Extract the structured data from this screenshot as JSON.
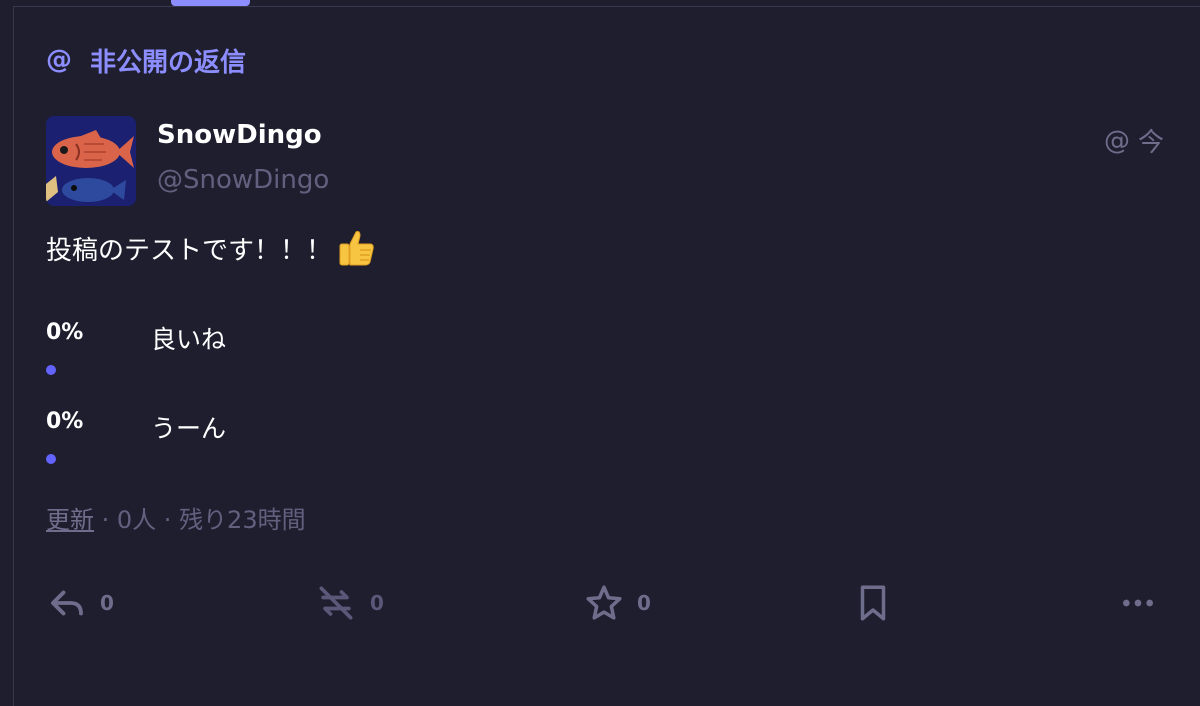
{
  "header": {
    "title": "非公開の返信",
    "at_symbol": "@"
  },
  "post": {
    "display_name": "SnowDingo",
    "handle": "@SnowDingo",
    "visibility_symbol": "@",
    "time": "今",
    "content": "投稿のテストです！！！",
    "content_emoji": "thumbs-up"
  },
  "poll": {
    "options": [
      {
        "percent": "0%",
        "label": "良いね",
        "fill": 0
      },
      {
        "percent": "0%",
        "label": "うーん",
        "fill": 0
      }
    ],
    "footer": {
      "refresh": "更新",
      "sep1": " · ",
      "voters": "0人",
      "sep2": " · ",
      "remaining": "残り23時間"
    }
  },
  "actions": {
    "reply_count": "0",
    "boost_count": "0",
    "favourite_count": "0"
  },
  "colors": {
    "background": "#1f1e2e",
    "accent": "#8c8dff",
    "muted": "#62607f",
    "bar": "#6364ff"
  }
}
